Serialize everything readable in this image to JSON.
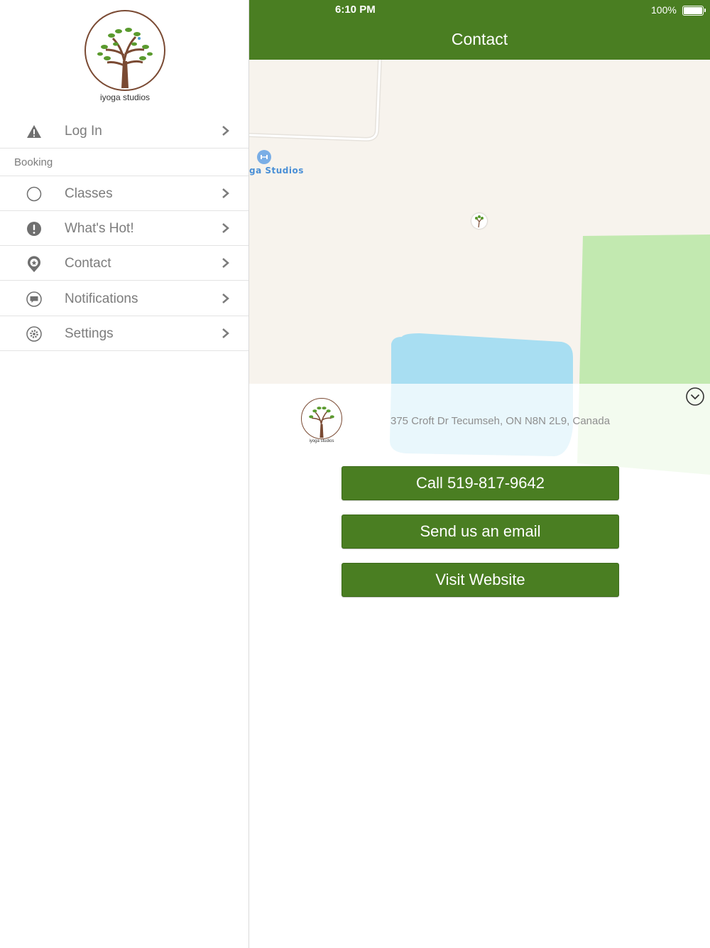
{
  "status_bar": {
    "time": "6:10 PM",
    "battery": "100%"
  },
  "nav": {
    "title": "Contact"
  },
  "sidebar": {
    "logo_text": "iyoga studios",
    "login": {
      "label": "Log In",
      "icon": "warning-icon"
    },
    "section_header": "Booking",
    "items": [
      {
        "label": "Classes",
        "icon": "circle-icon"
      },
      {
        "label": "What's Hot!",
        "icon": "exclamation-icon"
      },
      {
        "label": "Contact",
        "icon": "location-pin-icon"
      },
      {
        "label": "Notifications",
        "icon": "chat-bubble-icon"
      },
      {
        "label": "Settings",
        "icon": "gear-icon"
      }
    ]
  },
  "map": {
    "poi_label": "ga Studios"
  },
  "card": {
    "logo_text": "iyoga studios",
    "address": "375 Croft Dr Tecumseh, ON N8N 2L9, Canada",
    "buttons": {
      "call": "Call 519-817-9642",
      "email": "Send us an email",
      "website": "Visit Website"
    }
  },
  "colors": {
    "brand_green": "#4a7e22",
    "map_park": "#c2e9b0",
    "map_water": "#a8def2",
    "map_bg": "#f7f3ed"
  }
}
